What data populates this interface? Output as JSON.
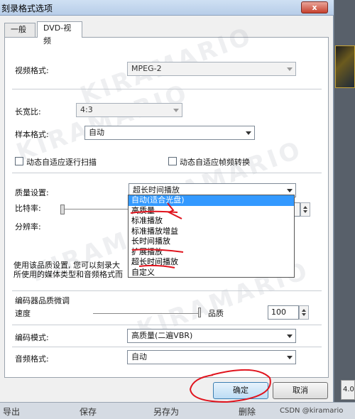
{
  "window": {
    "title": "刻录格式选项",
    "close_label": "x"
  },
  "tabs": [
    {
      "label": "一般"
    },
    {
      "label": "DVD-视频"
    }
  ],
  "video": {
    "format_label": "视频格式:",
    "format_value": "MPEG-2",
    "aspect_label": "长宽比:",
    "aspect_value": "4:3",
    "sample_label": "样本格式:",
    "sample_value": "自动",
    "chk_scan": "动态自适应逐行扫描",
    "chk_frame": "动态自适应帧频转换"
  },
  "quality": {
    "label": "质量设置:",
    "selected": "超长时间播放",
    "options": [
      "自动(适合光盘)",
      "高质量",
      "标准播放",
      "标准播放增益",
      "长时间播放",
      "扩展播放",
      "超长时间播放",
      "自定义"
    ],
    "highlight_index": 0,
    "bitrate_label": "比特率:",
    "resolution_label": "分辨率:",
    "desc_line1": "使用该品质设置, 您可以刻录大",
    "desc_line2": "所使用的媒体类型和音频格式而"
  },
  "encode": {
    "group_label": "编码器品质微调",
    "speed_label": "速度",
    "quality_label": "品质",
    "quality_value": "100",
    "mode_label": "编码模式:",
    "mode_value": "高质量(二遍VBR)",
    "audio_label": "音频格式:",
    "audio_value": "自动"
  },
  "buttons": {
    "ok": "确定",
    "cancel": "取消"
  },
  "taskbar": {
    "export": "导出",
    "save": "保存",
    "save_as": "另存为",
    "delete": "删除",
    "credit": "CSDN @kiramario"
  },
  "side": {
    "value": "4.0"
  },
  "watermark": "KIRAMARIO"
}
